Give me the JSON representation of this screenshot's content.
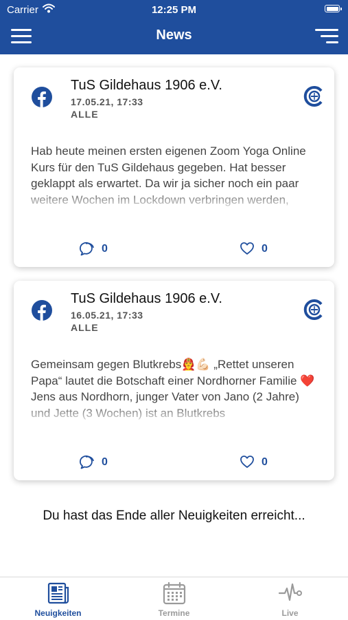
{
  "status_bar": {
    "carrier": "Carrier",
    "time": "12:25 PM"
  },
  "nav": {
    "title": "News",
    "menu_icon": "hamburger-icon",
    "filter_icon": "filter-icon"
  },
  "posts": [
    {
      "author": "TuS Gildehaus 1906 e.V.",
      "date": "17.05.21, 17:33",
      "category": "ALLE",
      "text": "Hab heute meinen ersten eigenen Zoom Yoga Online Kurs für den TuS Gildehaus gegeben. Hat besser geklappt als erwartet. Da wir ja sicher noch ein paar weitere Wochen im Lockdown verbringen werden,",
      "comments": "0",
      "likes": "0",
      "source_icon": "facebook-icon"
    },
    {
      "author": "TuS Gildehaus 1906 e.V.",
      "date": "16.05.21, 17:33",
      "category": "ALLE",
      "text": "Gemeinsam gegen Blutkrebs👨‍🚒💪🏻 „Rettet unseren Papa“ lautet die Botschaft einer Nordhorner Familie ❤️ Jens aus Nordhorn, junger Vater von Jano (2 Jahre) und Jette (3 Wochen) ist an Blutkrebs",
      "comments": "0",
      "likes": "0",
      "source_icon": "facebook-icon"
    }
  ],
  "end_message": "Du hast das Ende aller Neuigkeiten erreicht...",
  "tabs": [
    {
      "label": "Neuigkeiten",
      "icon": "newspaper-icon",
      "active": true
    },
    {
      "label": "Termine",
      "icon": "calendar-icon",
      "active": false
    },
    {
      "label": "Live",
      "icon": "pulse-icon",
      "active": false
    }
  ],
  "colors": {
    "brand": "#1f4e9d",
    "facebook": "#1f4e9d",
    "inactive": "#9a9a9a"
  }
}
